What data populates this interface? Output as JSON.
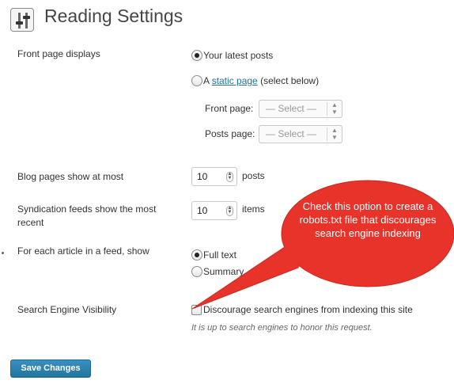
{
  "page": {
    "title": "Reading Settings",
    "icon": "settings-sliders-icon"
  },
  "front_page": {
    "label": "Front page displays",
    "option_latest": "Your latest posts",
    "option_static_prefix": "A ",
    "option_static_link": "static page",
    "option_static_suffix": " (select below)",
    "front_page_label": "Front page:",
    "front_page_value": "— Select —",
    "posts_page_label": "Posts page:",
    "posts_page_value": "— Select —",
    "selected": "latest"
  },
  "blog_pages": {
    "label": "Blog pages show at most",
    "value": "10",
    "unit": "posts"
  },
  "syndication": {
    "label": "Syndication feeds show the most recent",
    "value": "10",
    "unit": "items"
  },
  "feed_article": {
    "label": "For each article in a feed, show",
    "option_full": "Full text",
    "option_summary": "Summary",
    "selected": "full"
  },
  "visibility": {
    "label": "Search Engine Visibility",
    "checkbox_label": "Discourage search engines from indexing this site",
    "checked": false,
    "description": "It is up to search engines to honor this request."
  },
  "actions": {
    "save_label": "Save Changes"
  },
  "annotation": {
    "callout_text": "Check this option to create a robots.txt file that discourages search engine indexing",
    "color": "#e8332a"
  },
  "colors": {
    "link": "#21759b",
    "button": "#21759b"
  }
}
